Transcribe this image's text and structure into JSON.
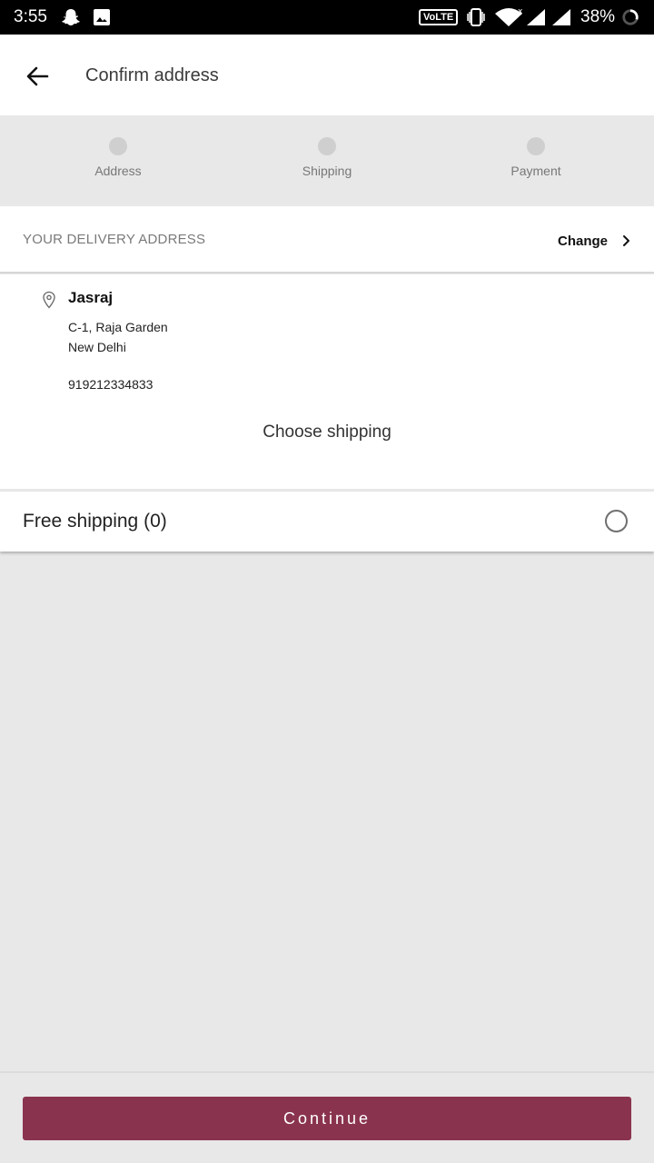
{
  "status_bar": {
    "time": "3:55",
    "volte": "VoLTE",
    "battery": "38%",
    "icons": [
      "snapchat-icon",
      "gallery-icon",
      "vibrate-icon",
      "wifi-icon",
      "signal-icon",
      "signal-icon-2",
      "battery-icon"
    ]
  },
  "header": {
    "title": "Confirm address",
    "back_icon": "arrow-back-icon"
  },
  "steps": [
    {
      "label": "Address"
    },
    {
      "label": "Shipping"
    },
    {
      "label": "Payment"
    }
  ],
  "delivery": {
    "section_title": "YOUR DELIVERY ADDRESS",
    "change_label": "Change",
    "name": "Jasraj",
    "line1": "C-1, Raja Garden",
    "line2": "New Delhi",
    "phone": "919212334833"
  },
  "shipping": {
    "heading": "Choose shipping",
    "option_label": "Free shipping (0)",
    "option_selected": false
  },
  "footer": {
    "continue_label": "Continue"
  },
  "colors": {
    "accent": "#8a334f",
    "background": "#e8e8e8"
  }
}
